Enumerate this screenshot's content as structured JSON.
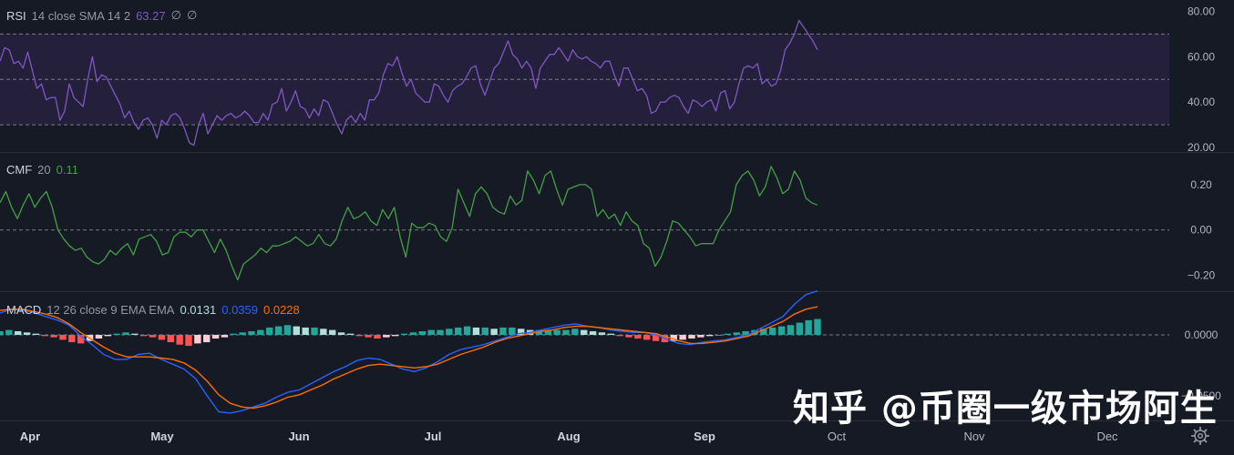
{
  "colors": {
    "background": "#161a25",
    "rsi_line": "#7e57c2",
    "rsi_band": "#2a2344",
    "cmf_line": "#43a047",
    "macd_line": "#2962ff",
    "signal_line": "#ff6d00",
    "hist_pos_strong": "#26a69a",
    "hist_pos_weak": "#b2dfdb",
    "hist_neg_strong": "#ff5252",
    "hist_neg_weak": "#ffcdd2",
    "axis_text": "#b2b5be"
  },
  "legends": {
    "rsi": {
      "title": "RSI",
      "params": "14 close SMA 14 2",
      "value": "63.27",
      "extra1": "∅",
      "extra2": "∅"
    },
    "cmf": {
      "title": "CMF",
      "params": "20",
      "value": "0.11"
    },
    "macd": {
      "title": "MACD",
      "params": "12 26 close 9 EMA EMA",
      "hist": "0.0131",
      "macd": "0.0359",
      "signal": "0.0228"
    }
  },
  "watermark": "知乎 @币圈一级市场阿生",
  "settings_icon": "gear-icon",
  "chart_data": [
    {
      "type": "line",
      "name": "RSI",
      "ylim": [
        18,
        85
      ],
      "y_ticks": [
        "80.00",
        "60.00",
        "40.00",
        "20.00"
      ],
      "y_tick_values": [
        80,
        60,
        40,
        20
      ],
      "band": [
        30,
        70
      ],
      "midline": 50,
      "values": [
        58,
        64,
        63,
        57,
        58,
        55,
        62,
        54,
        46,
        48,
        41,
        42,
        42,
        32,
        36,
        48,
        42,
        40,
        38,
        50,
        60,
        49,
        52,
        51,
        47,
        43,
        39,
        33,
        36,
        31,
        28,
        32,
        33,
        30,
        24,
        32,
        30,
        34,
        35,
        33,
        28,
        22,
        21,
        30,
        35,
        26,
        30,
        34,
        32,
        34,
        35,
        33,
        34,
        36,
        34,
        31,
        31,
        35,
        32,
        39,
        40,
        46,
        36,
        40,
        45,
        38,
        37,
        33,
        37,
        34,
        41,
        40,
        35,
        30,
        26,
        32,
        34,
        31,
        35,
        32,
        41,
        41,
        44,
        52,
        57,
        56,
        60,
        53,
        47,
        50,
        44,
        42,
        40,
        40,
        48,
        47,
        43,
        40,
        45,
        47,
        48,
        51,
        55,
        56,
        48,
        43,
        49,
        55,
        57,
        62,
        67,
        61,
        59,
        55,
        58,
        55,
        46,
        55,
        58,
        61,
        61,
        64,
        61,
        58,
        63,
        60,
        59,
        60,
        58,
        57,
        55,
        58,
        58,
        52,
        47,
        55,
        55,
        50,
        45,
        46,
        43,
        35,
        36,
        40,
        40,
        42,
        43,
        42,
        38,
        35,
        41,
        40,
        38,
        40,
        41,
        36,
        44,
        45,
        37,
        40,
        48,
        55,
        56,
        55,
        57,
        48,
        50,
        47,
        48,
        54,
        63,
        66,
        70,
        76,
        73,
        70,
        67,
        63
      ]
    },
    {
      "type": "line",
      "name": "CMF",
      "ylim": [
        -0.27,
        0.34
      ],
      "y_ticks": [
        "0.20",
        "0.00",
        "−0.20"
      ],
      "y_tick_values": [
        0.2,
        0.0,
        -0.2
      ],
      "zero_line": 0,
      "values": [
        0.12,
        0.17,
        0.1,
        0.05,
        0.11,
        0.16,
        0.1,
        0.14,
        0.17,
        0.1,
        0.0,
        -0.04,
        -0.07,
        -0.09,
        -0.08,
        -0.12,
        -0.14,
        -0.15,
        -0.13,
        -0.09,
        -0.11,
        -0.08,
        -0.06,
        -0.11,
        -0.04,
        -0.03,
        -0.02,
        -0.05,
        -0.11,
        -0.1,
        -0.03,
        -0.01,
        -0.01,
        -0.03,
        0.0,
        0.0,
        -0.05,
        -0.1,
        -0.04,
        -0.09,
        -0.16,
        -0.22,
        -0.15,
        -0.13,
        -0.11,
        -0.08,
        -0.1,
        -0.07,
        -0.07,
        -0.06,
        -0.05,
        -0.03,
        -0.05,
        -0.07,
        -0.06,
        -0.02,
        -0.06,
        -0.07,
        -0.04,
        0.04,
        0.1,
        0.05,
        0.06,
        0.08,
        0.04,
        0.02,
        0.09,
        0.05,
        0.1,
        -0.03,
        -0.12,
        0.03,
        0.01,
        0.01,
        0.03,
        0.02,
        -0.03,
        -0.05,
        0.01,
        0.18,
        0.12,
        0.06,
        0.16,
        0.19,
        0.16,
        0.1,
        0.08,
        0.07,
        0.15,
        0.11,
        0.13,
        0.26,
        0.22,
        0.16,
        0.24,
        0.26,
        0.18,
        0.11,
        0.18,
        0.19,
        0.2,
        0.2,
        0.18,
        0.06,
        0.09,
        0.05,
        0.07,
        0.02,
        0.08,
        0.04,
        0.02,
        -0.06,
        -0.08,
        -0.16,
        -0.12,
        -0.05,
        0.04,
        0.03,
        0.0,
        -0.03,
        -0.07,
        -0.06,
        -0.06,
        -0.06,
        0.0,
        0.04,
        0.08,
        0.2,
        0.24,
        0.26,
        0.22,
        0.15,
        0.19,
        0.28,
        0.23,
        0.16,
        0.18,
        0.26,
        0.22,
        0.14,
        0.12,
        0.11
      ]
    },
    {
      "type": "line",
      "name": "MACD",
      "ylim": [
        -0.07,
        0.035
      ],
      "y_ticks": [
        "0.0000",
        "−0.0500"
      ],
      "y_tick_values": [
        0.0,
        -0.05
      ],
      "zero_line": 0,
      "macd": [
        0.018,
        0.021,
        0.02,
        0.018,
        0.015,
        0.012,
        0.008,
        -0.001,
        -0.008,
        -0.016,
        -0.02,
        -0.02,
        -0.016,
        -0.015,
        -0.02,
        -0.024,
        -0.028,
        -0.036,
        -0.05,
        -0.063,
        -0.064,
        -0.062,
        -0.059,
        -0.056,
        -0.051,
        -0.047,
        -0.045,
        -0.04,
        -0.035,
        -0.03,
        -0.026,
        -0.021,
        -0.019,
        -0.02,
        -0.024,
        -0.028,
        -0.03,
        -0.027,
        -0.022,
        -0.016,
        -0.012,
        -0.01,
        -0.008,
        -0.005,
        -0.002,
        0.001,
        0.002,
        0.004,
        0.006,
        0.008,
        0.009,
        0.007,
        0.006,
        0.004,
        0.003,
        0.002,
        0.002,
        0.0,
        -0.004,
        -0.007,
        -0.008,
        -0.006,
        -0.005,
        -0.004,
        -0.002,
        0.0,
        0.005,
        0.01,
        0.015,
        0.025,
        0.033,
        0.036
      ],
      "signal": [
        0.02,
        0.021,
        0.021,
        0.019,
        0.017,
        0.014,
        0.009,
        0.002,
        -0.004,
        -0.01,
        -0.015,
        -0.018,
        -0.018,
        -0.018,
        -0.019,
        -0.02,
        -0.023,
        -0.029,
        -0.038,
        -0.049,
        -0.056,
        -0.059,
        -0.06,
        -0.058,
        -0.055,
        -0.051,
        -0.049,
        -0.045,
        -0.041,
        -0.036,
        -0.032,
        -0.028,
        -0.025,
        -0.024,
        -0.025,
        -0.026,
        -0.027,
        -0.026,
        -0.024,
        -0.02,
        -0.016,
        -0.013,
        -0.01,
        -0.006,
        -0.003,
        -0.001,
        0.001,
        0.003,
        0.004,
        0.006,
        0.007,
        0.007,
        0.006,
        0.005,
        0.004,
        0.003,
        0.002,
        0.001,
        -0.002,
        -0.005,
        -0.007,
        -0.007,
        -0.006,
        -0.005,
        -0.003,
        -0.001,
        0.003,
        0.007,
        0.011,
        0.017,
        0.021,
        0.023
      ],
      "histogram": [
        0.003,
        0.004,
        0.003,
        0.002,
        0.001,
        -0.001,
        -0.002,
        -0.004,
        -0.006,
        -0.007,
        -0.005,
        -0.003,
        -0.001,
        0.001,
        0.002,
        0.001,
        -0.001,
        -0.002,
        -0.004,
        -0.006,
        -0.008,
        -0.009,
        -0.007,
        -0.006,
        -0.003,
        -0.002,
        0.001,
        0.002,
        0.003,
        0.004,
        0.006,
        0.007,
        0.008,
        0.007,
        0.006,
        0.006,
        0.005,
        0.004,
        0.002,
        0.001,
        -0.001,
        -0.002,
        -0.003,
        -0.002,
        -0.001,
        0.001,
        0.002,
        0.003,
        0.004,
        0.004,
        0.005,
        0.006,
        0.007,
        0.006,
        0.006,
        0.005,
        0.006,
        0.006,
        0.005,
        0.004,
        0.004,
        0.004,
        0.004,
        0.004,
        0.005,
        0.004,
        0.003,
        0.002,
        0.001,
        -0.001,
        -0.002,
        -0.003,
        -0.004,
        -0.005,
        -0.006,
        -0.005,
        -0.004,
        -0.003,
        -0.002,
        -0.001,
        0.0,
        0.001,
        0.002,
        0.003,
        0.004,
        0.005,
        0.006,
        0.007,
        0.008,
        0.01,
        0.012,
        0.013
      ]
    }
  ],
  "x_axis": {
    "ticks": [
      "Apr",
      "May",
      "Jun",
      "Jul",
      "Aug",
      "Sep",
      "Oct",
      "Nov",
      "Dec"
    ],
    "bold_ticks": [
      "Apr",
      "May",
      "Jun",
      "Jul",
      "Aug",
      "Sep"
    ]
  }
}
